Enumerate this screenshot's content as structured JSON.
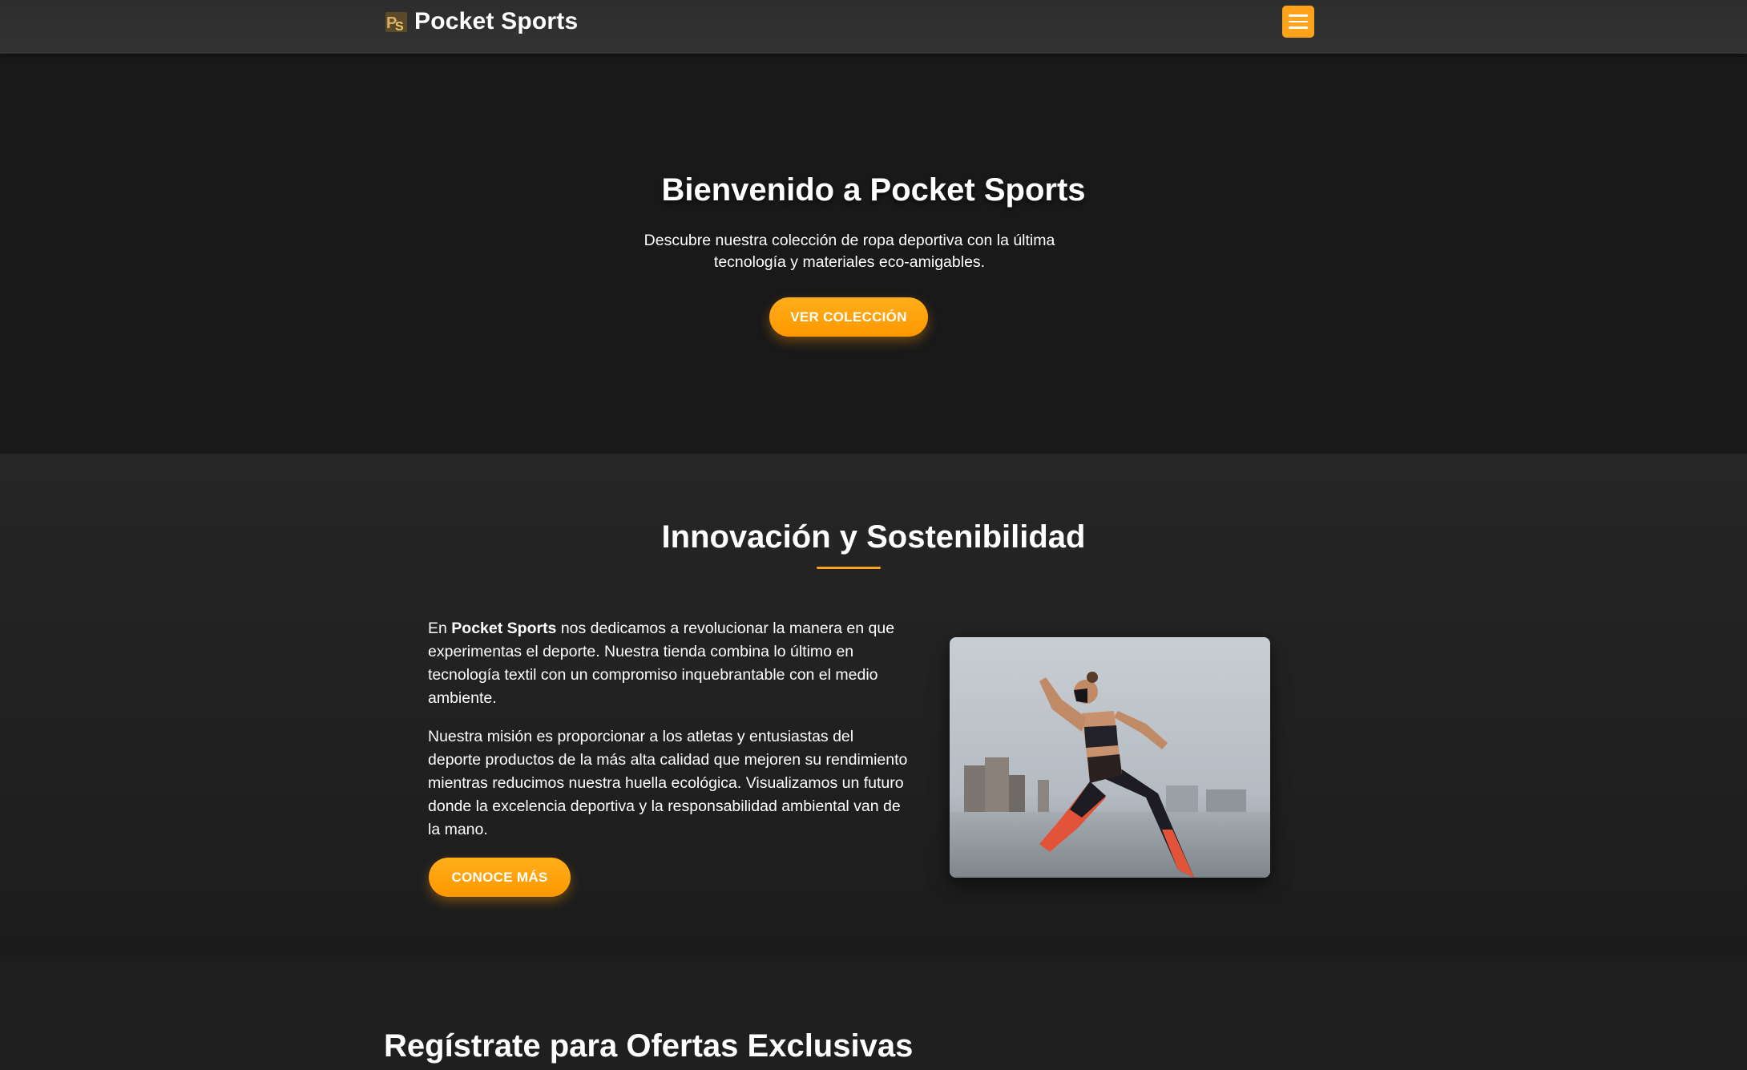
{
  "nav": {
    "brand_name": "Pocket Sports",
    "logo_icon": "pocket-sports-logo-icon",
    "menu_icon": "hamburger-menu-icon"
  },
  "hero": {
    "title": "Bienvenido a Pocket Sports",
    "subtitle": "Descubre nuestra colección de ropa deportiva con la última tecnología y materiales eco-amigables.",
    "cta_label": "VER COLECCIÓN"
  },
  "about": {
    "title": "Innovación y Sostenibilidad",
    "p1_prefix": "En ",
    "p1_brand": "Pocket Sports",
    "p1_rest": " nos dedicamos a revolucionar la manera en que experimentas el deporte. Nuestra tienda combina lo último en tecnología textil con un compromiso inquebrantable con el medio ambiente.",
    "p2": "Nuestra misión es proporcionar a los atletas y entusiastas del deporte productos de la más alta calidad que mejoren su rendimiento mientras reducimos nuestra huella ecológica. Visualizamos un futuro donde la excelencia deportiva y la responsabilidad ambiental van de la mano.",
    "cta_label": "CONOCE MÁS",
    "image_alt": "Atleta corriendo con mascarilla deportiva"
  },
  "newsletter": {
    "title": "Regístrate para Ofertas Exclusivas"
  },
  "colors": {
    "accent": "#ffa31a",
    "background": "#1a1a1a",
    "navbar": "#333333",
    "text": "#ffffff"
  }
}
